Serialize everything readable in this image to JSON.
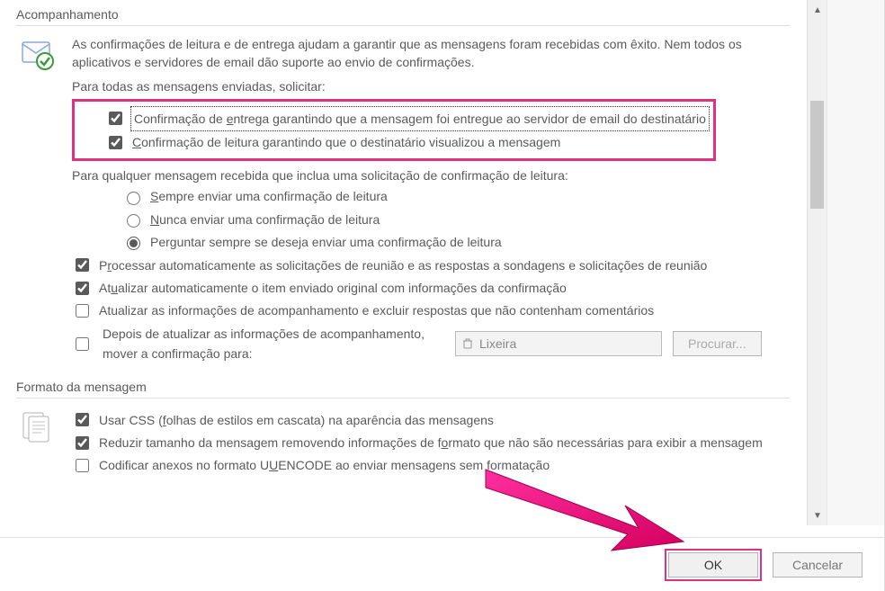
{
  "sections": {
    "tracking": {
      "title": "Acompanhamento",
      "description": "As confirmações de leitura e de entrega ajudam a garantir que as mensagens foram recebidas com êxito. Nem todos os aplicativos e servidores de email dão suporte ao envio de confirmações.",
      "request_for_all_label": "Para todas as mensagens enviadas, solicitar:",
      "delivery_receipt": {
        "label_pre": "Confirmação de ",
        "u": "e",
        "label_post": "ntrega garantindo que a mensagem foi entregue ao servidor de email do destinatário",
        "checked": true
      },
      "read_receipt": {
        "u": "C",
        "label": "onfirmação de leitura garantindo que o destinatário visualizou a mensagem",
        "checked": true
      },
      "for_received_label": "Para qualquer mensagem recebida que inclua uma solicitação de confirmação de leitura:",
      "radios": {
        "always": {
          "u": "S",
          "label": "empre enviar uma confirmação de leitura",
          "selected": false
        },
        "never": {
          "u": "N",
          "label": "unca enviar uma confirmação de leitura",
          "selected": false
        },
        "ask": {
          "label_pre": "Perguntar sempre se dese",
          "u": "j",
          "label_post": "a enviar uma confirmação de leitura",
          "selected": true
        }
      },
      "process_auto": {
        "label_pre": "P",
        "u": "r",
        "label_post": "ocessar automaticamente as solicitações de reunião e as respostas a sondagens e solicitações de reunião",
        "checked": true
      },
      "update_original": {
        "label_pre": "At",
        "u": "u",
        "label_post": "alizar automaticamente o item enviado original com informações da confirmação",
        "checked": true
      },
      "update_exclude": {
        "label": "Atualizar as informações de acompanhamento e excluir respostas que não contenham comentários",
        "checked": false
      },
      "move_receipt": {
        "label": "Depois de atualizar as informações de acompanhamento, mover a confirmação para:",
        "checked": false,
        "folder": "Lixeira",
        "browse": "Procurar..."
      }
    },
    "format": {
      "title": "Formato da mensagem",
      "use_css": {
        "label_pre": "Usar CSS (",
        "u": "f",
        "label_post": "olhas de estilos em cascata) na aparência das mensagens",
        "checked": true
      },
      "reduce_size": {
        "label_pre": "Reduzir tamanho da mensagem removendo informações de f",
        "u": "o",
        "label_post": "rmato que não são necessárias para exibir a mensagem",
        "checked": true
      },
      "uuencode": {
        "label_pre": "Codificar anexos no formato U",
        "u": "U",
        "label_post": "ENCODE ao enviar mensagens sem formatação",
        "checked": false
      }
    }
  },
  "buttons": {
    "ok": "OK",
    "cancel": "Cancelar"
  }
}
